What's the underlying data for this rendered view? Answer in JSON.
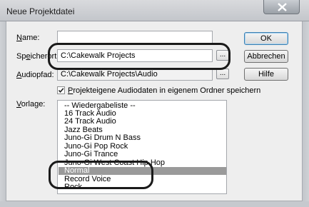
{
  "window": {
    "title": "Neue Projektdatei"
  },
  "form": {
    "name_label_mnemonic": "N",
    "name_label_rest": "ame:",
    "name_value": "",
    "speicherort_label_a": "Sp",
    "speicherort_label_mnemonic": "e",
    "speicherort_label_b": "icherort:",
    "speicherort_value": "C:\\Cakewalk Projects",
    "audiopfad_label_mnemonic": "A",
    "audiopfad_label_rest": "udiopfad:",
    "audiopfad_value": "C:\\Cakewalk Projects\\Audio",
    "browse_label": "...",
    "checkbox_mnemonic": "P",
    "checkbox_rest": "rojekteigene Audiodaten in eigenem Ordner speichern",
    "checkbox_checked": true,
    "vorlage_label_mnemonic": "V",
    "vorlage_label_rest": "orlage:"
  },
  "buttons": {
    "ok": "OK",
    "cancel": "Abbrechen",
    "help": "Hilfe"
  },
  "templates": {
    "items": [
      "-- Wiedergabeliste --",
      "16 Track Audio",
      "24 Track Audio",
      "Jazz Beats",
      "Juno-Gi Drum N Bass",
      "Juno-Gi Pop Rock",
      "Juno-Gi Trance",
      "Juno-Gi West Coast Hip Hop",
      "Normal",
      "Record Voice",
      "Rock"
    ],
    "selected": "Normal"
  }
}
